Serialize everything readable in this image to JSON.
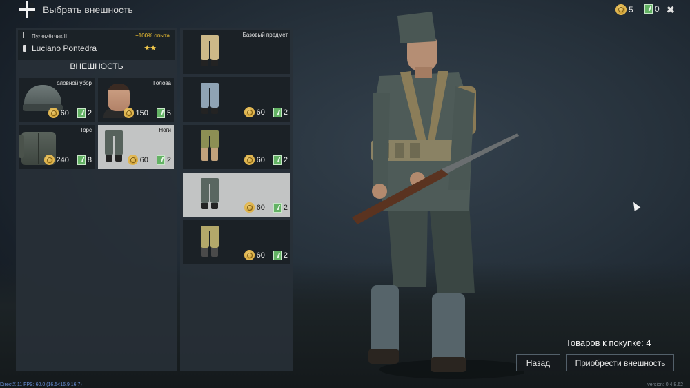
{
  "header": {
    "title": "Выбрать внешность",
    "coins": "5",
    "tickets": "0",
    "close_icon": "close-icon"
  },
  "soldier": {
    "class_label": "Пулемётчик II",
    "xp_bonus": "+100% опыта",
    "name": "Luciano Pontedra",
    "stars": "★★"
  },
  "section_title": "ВНЕШНОСТЬ",
  "slots": [
    {
      "label": "Головной убор",
      "coins": "60",
      "tickets": "2",
      "icon": "cap-icon"
    },
    {
      "label": "Голова",
      "coins": "150",
      "tickets": "5",
      "icon": "head-icon"
    },
    {
      "label": "Торс",
      "coins": "240",
      "tickets": "8",
      "icon": "jacket-icon"
    },
    {
      "label": "Ноги",
      "coins": "60",
      "tickets": "2",
      "icon": "trousers-icon",
      "selected": true
    }
  ],
  "items": [
    {
      "label": "Базовый предмет",
      "coins": "",
      "tickets": "",
      "color": "#cdb988"
    },
    {
      "label": "",
      "coins": "60",
      "tickets": "2",
      "color": "#8fa3b4"
    },
    {
      "label": "",
      "coins": "60",
      "tickets": "2",
      "color": "#8c8f54"
    },
    {
      "label": "",
      "coins": "60",
      "tickets": "2",
      "color": "#596660",
      "selected": true
    },
    {
      "label": "",
      "coins": "60",
      "tickets": "2",
      "color": "#b3a86a"
    }
  ],
  "footer": {
    "items_to_buy": "Товаров к покупке: 4",
    "back_button": "Назад",
    "buy_button": "Приобрести внешность",
    "debug": "DirectX 11 FPS: 60.0 (16.5<16.9 16.7)",
    "version": "version: 0.4.8.62"
  }
}
